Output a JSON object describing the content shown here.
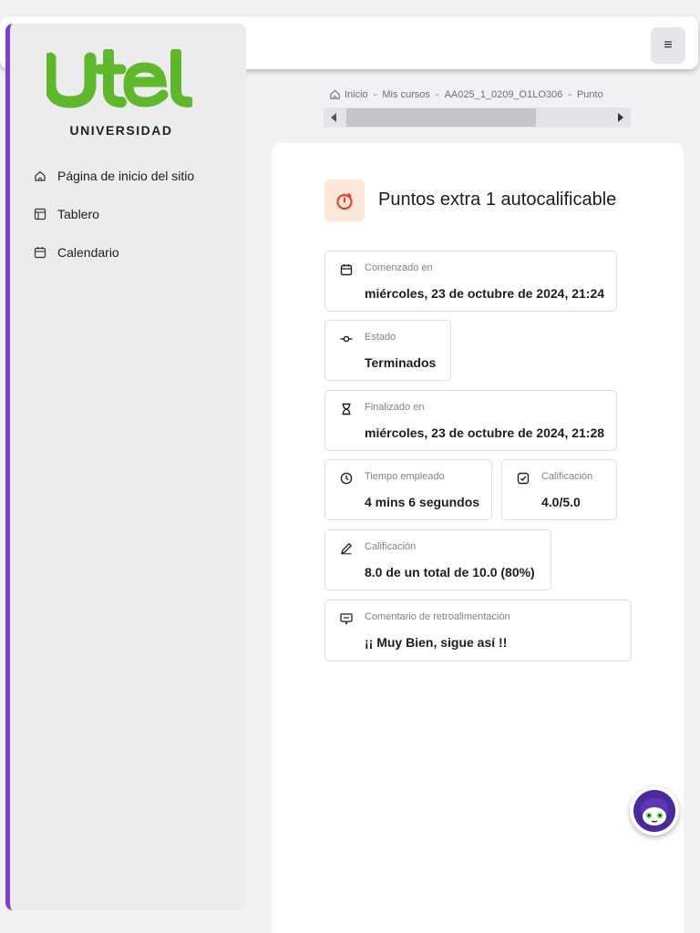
{
  "brand": {
    "logo_text": "UTEL",
    "subtitle": "UNIVERSIDAD",
    "accent_color": "#5fb82b",
    "sidebar_accent": "#7a3fd0"
  },
  "header": {
    "menu_icon": "hamburger-icon",
    "menu_glyph": "≡"
  },
  "sidebar": {
    "items": [
      {
        "label": "Página de inicio del sitio",
        "icon": "home-icon"
      },
      {
        "label": "Tablero",
        "icon": "dashboard-icon"
      },
      {
        "label": "Calendario",
        "icon": "calendar-icon"
      }
    ]
  },
  "breadcrumb": {
    "items": [
      "Inicio",
      "Mis cursos",
      "AA025_1_0209_O1LO306",
      "Punto"
    ],
    "separator": "-"
  },
  "page": {
    "title": "Puntos extra 1 autocalificable",
    "title_icon": "stopwatch-icon"
  },
  "info": {
    "started": {
      "label": "Comenzado en",
      "value": "miércoles, 23 de octubre de 2024, 21:24",
      "icon": "calendar-icon"
    },
    "state": {
      "label": "Estado",
      "value": "Terminados",
      "icon": "commit-icon"
    },
    "finished": {
      "label": "Finalizado en",
      "value": "miércoles, 23 de octubre de 2024, 21:28",
      "icon": "hourglass-icon"
    },
    "time_taken": {
      "label": "Tiempo empleado",
      "value": "4 mins 6 segundos",
      "icon": "clock-icon"
    },
    "marks": {
      "label": "Calificación",
      "value": "4.0/5.0",
      "icon": "checkbox-icon"
    },
    "grade": {
      "label": "Calificación",
      "value": "8.0 de un total de 10.0 (80%)",
      "icon": "pencil-icon"
    },
    "feedback": {
      "label": "Comentario de retroalimentación",
      "value": "¡¡ Muy Bien, sigue así !!",
      "icon": "comment-icon"
    }
  },
  "chat": {
    "icon": "chatbot-avatar-icon"
  }
}
